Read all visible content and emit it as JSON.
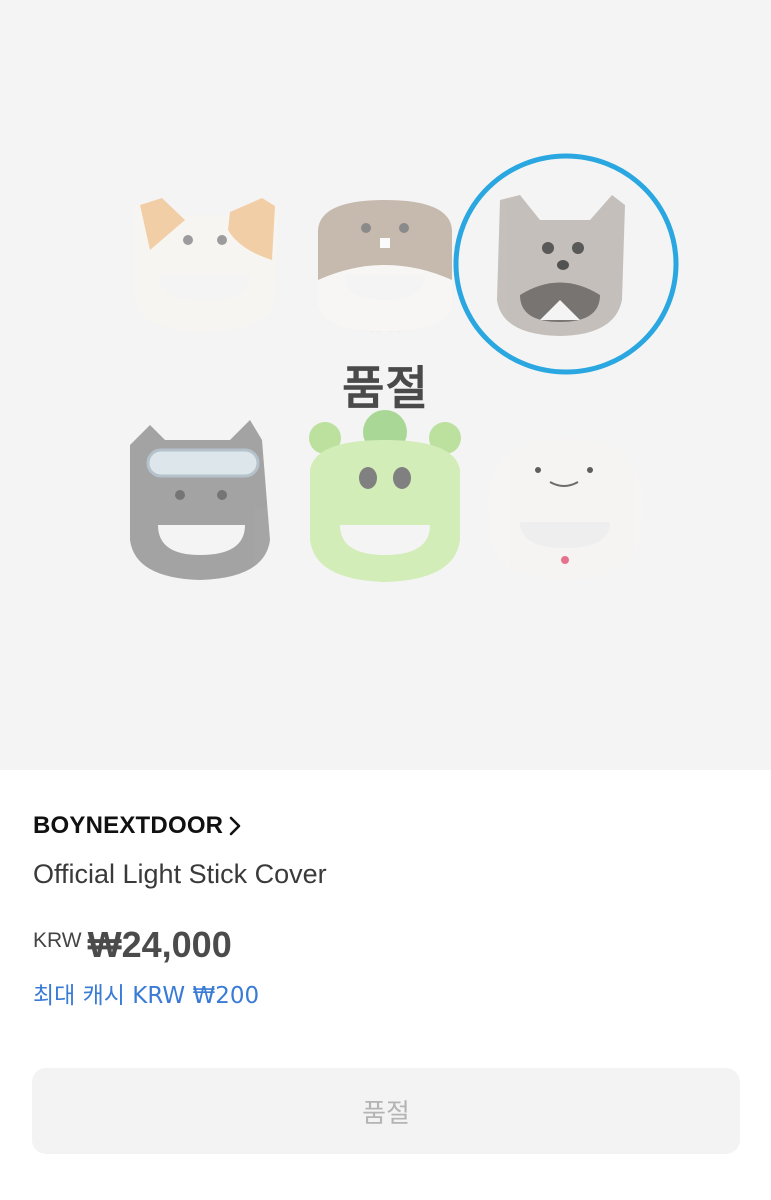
{
  "hero": {
    "status_overlay": "품절",
    "items": [
      {
        "name": "calico-cat-cover",
        "color": "#f3d3b0"
      },
      {
        "name": "hamster-cover",
        "color": "#d9cfc4"
      },
      {
        "name": "fox-dog-cover",
        "color": "#cfcac5"
      },
      {
        "name": "gray-cat-goggles-cover",
        "color": "#bcbcbc"
      },
      {
        "name": "green-creature-cover",
        "color": "#cfe9b6"
      },
      {
        "name": "white-ghost-cover",
        "color": "#f1efec"
      }
    ],
    "highlight_color": "#2aa7e0"
  },
  "product": {
    "brand": "BOYNEXTDOOR",
    "name": "Official Light Stick Cover",
    "currency": "KRW",
    "price": "₩24,000",
    "cash": "최대 캐시 KRW ₩200"
  },
  "action": {
    "button_label": "품절"
  },
  "colors": {
    "accent_blue": "#3a7bd5",
    "disabled_text": "#b4b4b4"
  }
}
